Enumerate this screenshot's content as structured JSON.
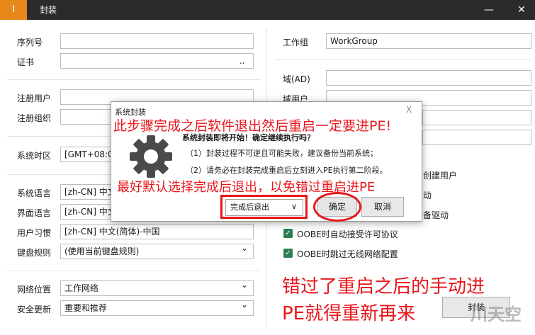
{
  "window": {
    "app_icon": "I",
    "title": "封装",
    "minimize": "—",
    "close": "✕"
  },
  "left_form": {
    "serial_label": "序列号",
    "serial_value": "",
    "cert_label": "证书",
    "cert_button": "..",
    "reg_user_label": "注册用户",
    "reg_org_label": "注册组织",
    "timezone_label": "系统时区",
    "timezone_value": "[GMT+08:0",
    "sys_lang_label": "系统语言",
    "sys_lang_value": "[zh-CN] 中文",
    "ui_lang_label": "界面语言",
    "ui_lang_value": "[zh-CN] 中文",
    "user_habit_label": "用户习惯",
    "user_habit_value": "[zh-CN] 中文(简体)-中国",
    "keyboard_label": "键盘规则",
    "keyboard_value": "(使用当前键盘规则)",
    "net_loc_label": "网络位置",
    "net_loc_value": "工作网络",
    "sec_update_label": "安全更新",
    "sec_update_value": "重要和推荐"
  },
  "right_form": {
    "workgroup_label": "工作组",
    "workgroup_value": "WorkGroup",
    "domain_label": "域(AD)",
    "domain_user_label": "域用户",
    "option_create_user": "创建用户",
    "option_2": "动",
    "option_3": "备驱动",
    "option_oobe_license": "OOBE时自动接受许可协议",
    "option_oobe_network": "OOBE时跳过无线网络配置",
    "seal_button": "封装"
  },
  "dialog": {
    "title": "系统封装",
    "close": "X",
    "heading": "系统封装即将开始！确定继续执行吗？",
    "line1": "（1）封装过程不可逆且可能失败，建议备份当前系统；",
    "line2": "（2）请务必在封装完成重启后立刻进入PE执行第二阶段。",
    "dropdown_value": "完成后退出",
    "ok_button": "确定",
    "cancel_button": "取消"
  },
  "annotations": {
    "top": "此步骤完成之后软件退出然后重启一定要进PE!",
    "middle": "最好默认选择完成后退出，以免错过重启进PE",
    "bottom_line1": "错过了重启之后的手动进",
    "bottom_line2": "PE就得重新再来"
  },
  "watermark": "川天空"
}
